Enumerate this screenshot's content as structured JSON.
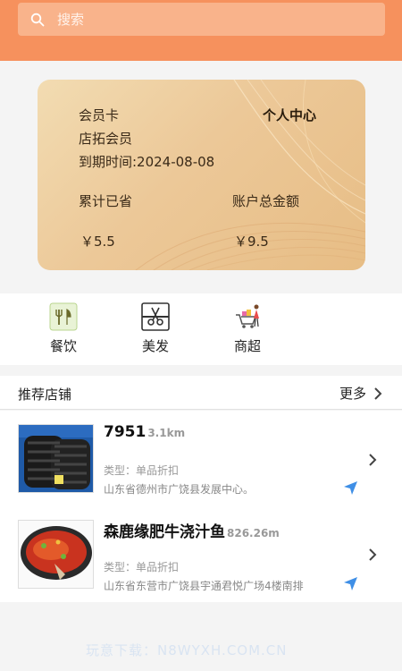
{
  "search": {
    "placeholder": "搜索",
    "icon": "search-icon"
  },
  "member_card": {
    "title": "会员卡",
    "center_label": "个人中心",
    "member_name": "店拓会员",
    "expiry": "到期时间:2024-08-08",
    "saved_label": "累计已省",
    "balance_label": "账户总金额",
    "saved_value": "￥5.5",
    "balance_value": "￥9.5"
  },
  "categories": [
    {
      "label": "餐饮",
      "icon": "dining-icon"
    },
    {
      "label": "美发",
      "icon": "haircut-icon"
    },
    {
      "label": "商超",
      "icon": "supermarket-icon"
    }
  ],
  "recommend": {
    "title": "推荐店铺",
    "more": "更多"
  },
  "shops": [
    {
      "name": "7951",
      "distance": "3.1km",
      "type": "类型：单品折扣",
      "address": "山东省德州市广饶县发展中心。",
      "image": "tires"
    },
    {
      "name": "森鹿缘肥牛浇汁鱼",
      "distance": "826.26m",
      "type": "类型：单品折扣",
      "address": "山东省东营市广饶县宇通君悦广场4楼南排",
      "image": "fish-dish"
    }
  ],
  "watermark": "玩意下载：N8WYXH.COM.CN",
  "colors": {
    "header": "#f6915d",
    "card_gold": "#ecc898",
    "nav_blue": "#3f8fe6"
  }
}
